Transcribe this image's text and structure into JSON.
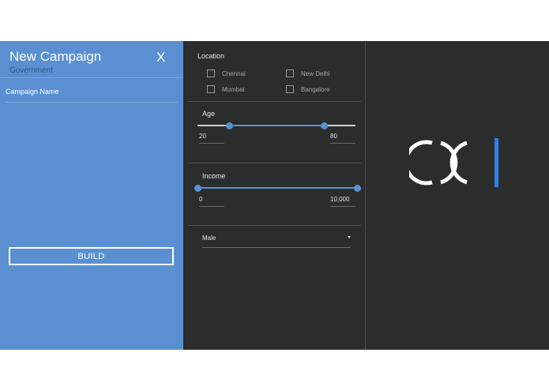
{
  "campaign": {
    "title": "New Campaign",
    "subtitle": "Government",
    "close_label": "X",
    "name_label": "Campaign Name",
    "build_label": "BUILD"
  },
  "filters": {
    "location": {
      "label": "Location",
      "options": [
        {
          "label": "Chennai",
          "checked": false
        },
        {
          "label": "New Delhi",
          "checked": false
        },
        {
          "label": "Mumbai",
          "checked": false
        },
        {
          "label": "Bangalore",
          "checked": false
        }
      ]
    },
    "age": {
      "label": "Age",
      "min": "20",
      "max": "80",
      "range_fraction": [
        0.2,
        0.8
      ]
    },
    "income": {
      "label": "Income",
      "min": "0",
      "max": "10,000",
      "range_fraction": [
        0.0,
        1.0
      ]
    },
    "gender": {
      "selected": "Male"
    }
  },
  "colors": {
    "accent": "#5a90d2",
    "panel": "#2b2c2c",
    "logo_bar": "#2f80ed"
  },
  "icons": {
    "close": "close-icon",
    "checkbox": "checkbox-icon",
    "dropdown": "chevron-down-icon",
    "logo": "brand-logo"
  }
}
